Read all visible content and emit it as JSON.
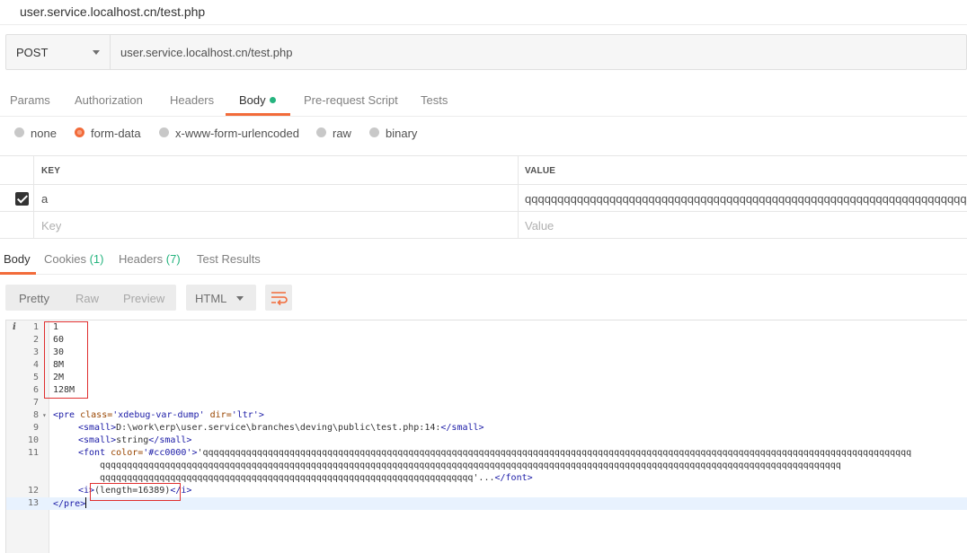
{
  "tab": {
    "title": "user.service.localhost.cn/test.php"
  },
  "request": {
    "method": "POST",
    "url": "user.service.localhost.cn/test.php"
  },
  "request_tabs": [
    {
      "label": "Params"
    },
    {
      "label": "Authorization"
    },
    {
      "label": "Headers"
    },
    {
      "label": "Body",
      "active": true
    },
    {
      "label": "Pre-request Script"
    },
    {
      "label": "Tests"
    }
  ],
  "body_types": [
    {
      "label": "none"
    },
    {
      "label": "form-data",
      "selected": true
    },
    {
      "label": "x-www-form-urlencoded"
    },
    {
      "label": "raw"
    },
    {
      "label": "binary"
    }
  ],
  "kv_table": {
    "key_header": "KEY",
    "value_header": "VALUE",
    "rows": [
      {
        "key": "a",
        "value": "qqqqqqqqqqqqqqqqqqqqqqqqqqqqqqqqqqqqqqqqqqqqqqqqqqqqqqqqqqqqqqqqqqqqqqqqqqqqqqqqqqq",
        "checked": true
      }
    ],
    "key_placeholder": "Key",
    "value_placeholder": "Value"
  },
  "response_tabs": [
    {
      "label": "Body",
      "count": ""
    },
    {
      "label": "Cookies",
      "count": "(1)"
    },
    {
      "label": "Headers",
      "count": "(7)"
    },
    {
      "label": "Test Results",
      "count": ""
    }
  ],
  "response_toolbar": {
    "views": [
      "Pretty",
      "Raw",
      "Preview"
    ],
    "format": "HTML"
  },
  "code": {
    "line_numbers": [
      "1",
      "2",
      "3",
      "4",
      "5",
      "6",
      "7",
      "8",
      "9",
      "10",
      "11",
      "",
      "",
      "12",
      "13"
    ],
    "plain_lines": [
      "1",
      "60",
      "30",
      "8M",
      "2M",
      "128M"
    ],
    "pre_open_tag": "<pre",
    "pre_attr1": " class=",
    "pre_val1": "'xdebug-var-dump'",
    "pre_attr2": " dir=",
    "pre_val2": "'ltr'",
    "pre_close": ">",
    "small_open": "<small>",
    "small_close": "</small>",
    "path_text": "D:\\work\\erp\\user.service\\branches\\deving\\public\\test.php:14:",
    "string_text": "string",
    "font_open": "<font",
    "font_attr": " color=",
    "font_val": "'#cc0000'",
    "font_gt": ">",
    "q1": "'qqqqqqqqqqqqqqqqqqqqqqqqqqqqqqqqqqqqqqqqqqqqqqqqqqqqqqqqqqqqqqqqqqqqqqqqqqqqqqqqqqqqqqqqqqqqqqqqqqqqqqqqqqqqqqqqqqqqqqqqqqqqqqqqqqq",
    "q2": "qqqqqqqqqqqqqqqqqqqqqqqqqqqqqqqqqqqqqqqqqqqqqqqqqqqqqqqqqqqqqqqqqqqqqqqqqqqqqqqqqqqqqqqqqqqqqqqqqqqqqqqqqqqqqqqqqqqqqqqqqqqqqqqqqqqqqqqqq",
    "q3": "qqqqqqqqqqqqqqqqqqqqqqqqqqqqqqqqqqqqqqqqqqqqqqqqqqqqqqqqqqqqqqqqqqqqq'...",
    "font_close": "</font>",
    "i_open": "<i>",
    "length_text": "(length=16389)",
    "i_close": "</i>",
    "pre_end": "</pre>"
  },
  "colors": {
    "accent": "#f26b3a",
    "green": "#26b47f",
    "annotation": "#e03030"
  }
}
